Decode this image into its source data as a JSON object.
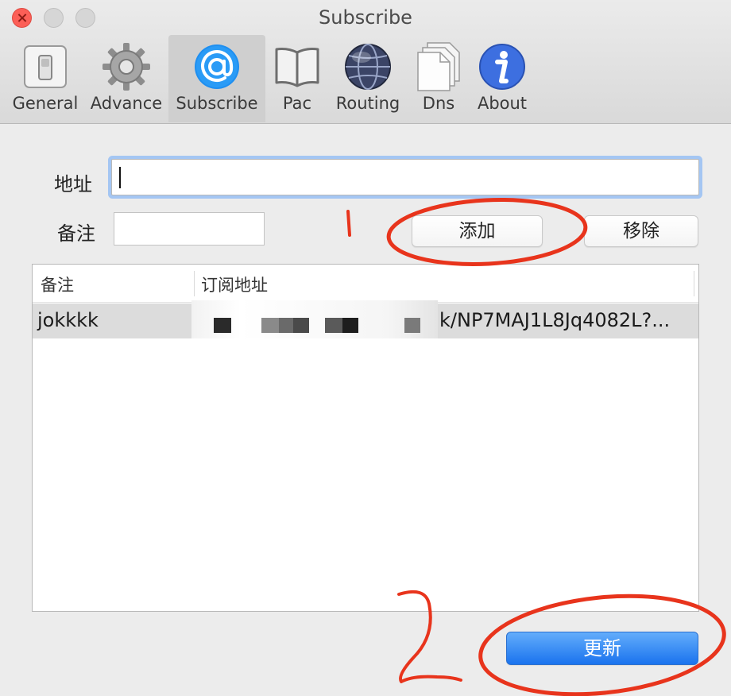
{
  "window": {
    "title": "Subscribe"
  },
  "toolbar": {
    "items": [
      {
        "label": "General",
        "icon": "switch-icon"
      },
      {
        "label": "Advance",
        "icon": "gear-icon"
      },
      {
        "label": "Subscribe",
        "icon": "at-icon",
        "selected": true
      },
      {
        "label": "Pac",
        "icon": "book-icon"
      },
      {
        "label": "Routing",
        "icon": "globe-icon"
      },
      {
        "label": "Dns",
        "icon": "documents-icon"
      },
      {
        "label": "About",
        "icon": "info-icon"
      }
    ]
  },
  "form": {
    "url_label": "地址",
    "url_value": "",
    "note_label": "备注",
    "note_value": "",
    "add_button": "添加",
    "remove_button": "移除"
  },
  "table": {
    "columns": [
      "备注",
      "订阅地址"
    ],
    "rows": [
      {
        "note": "jokkkk",
        "url_visible": "k/NP7MAJ1L8Jq4082L?..."
      }
    ]
  },
  "footer": {
    "update_button": "更新"
  },
  "colors": {
    "accent": "#1a73ee",
    "annotation": "#e8341c",
    "selection": "#dcdcdc"
  }
}
